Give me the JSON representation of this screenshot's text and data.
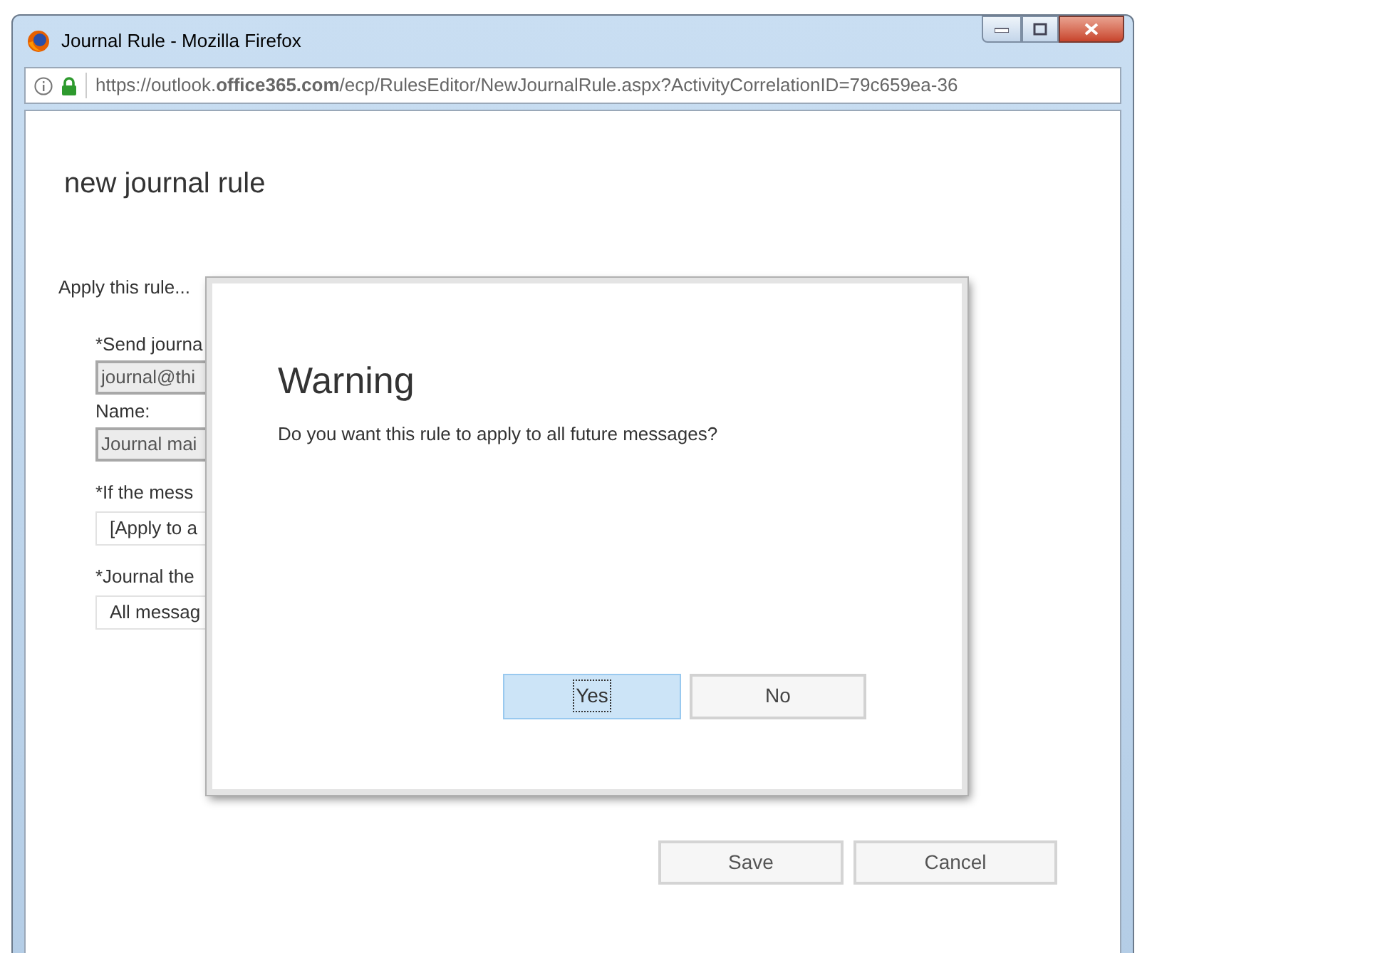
{
  "window": {
    "title": "Journal Rule - Mozilla Firefox"
  },
  "address_bar": {
    "url": "https://outlook.**office365.com**/ecp/RulesEditor/NewJournalRule.aspx?ActivityCorrelationID=79c659ea-36"
  },
  "page": {
    "heading": "new journal rule",
    "section_label": "Apply this rule...",
    "fields": [
      {
        "label": "*Send journa",
        "value": "journal@thi",
        "disabled": true
      },
      {
        "label": "Name:",
        "value": "Journal mai",
        "disabled": true
      },
      {
        "label": "*If the mess",
        "value": "[Apply to a",
        "disabled": false
      },
      {
        "label": "*Journal the",
        "value": "All messag",
        "disabled": false
      }
    ],
    "buttons": [
      {
        "label": "Save"
      },
      {
        "label": "Cancel"
      }
    ]
  },
  "dialog": {
    "title": "Warning",
    "message": "Do you want this rule to apply to all future messages?",
    "buttons": [
      {
        "label": "Yes",
        "selected": true
      },
      {
        "label": "No",
        "selected": false
      }
    ]
  }
}
